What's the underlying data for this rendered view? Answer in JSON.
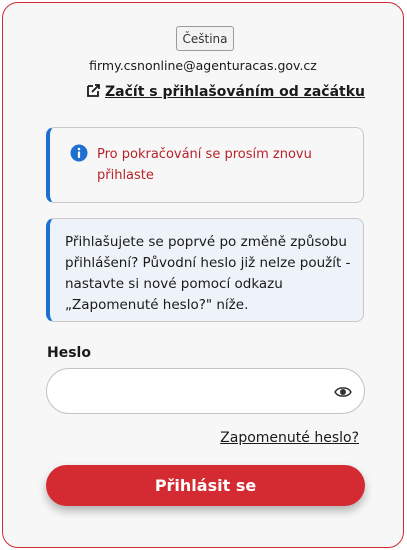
{
  "language_button": "Čeština",
  "user_email": "firmy.csnonline@agenturacas.gov.cz",
  "restart_link": "Začít s přihlašováním od začátku",
  "info_alert": {
    "icon": "info-icon",
    "text": "Pro pokračování se prosím znovu přihlaste"
  },
  "notice": {
    "text": "Přihlašujete se poprvé po změně způsobu přihlášení? Původní heslo již nelze použít - nastavte si nové pomocí odkazu „Zapomenuté heslo?\" níže."
  },
  "password": {
    "label": "Heslo",
    "value": "",
    "toggle_icon": "eye-icon"
  },
  "forgot_link": "Zapomenuté heslo?",
  "login_button": "Přihlásit se",
  "colors": {
    "accent": "#d42a32",
    "info_blue": "#1f6fd1",
    "alert_text": "#b8232b"
  }
}
